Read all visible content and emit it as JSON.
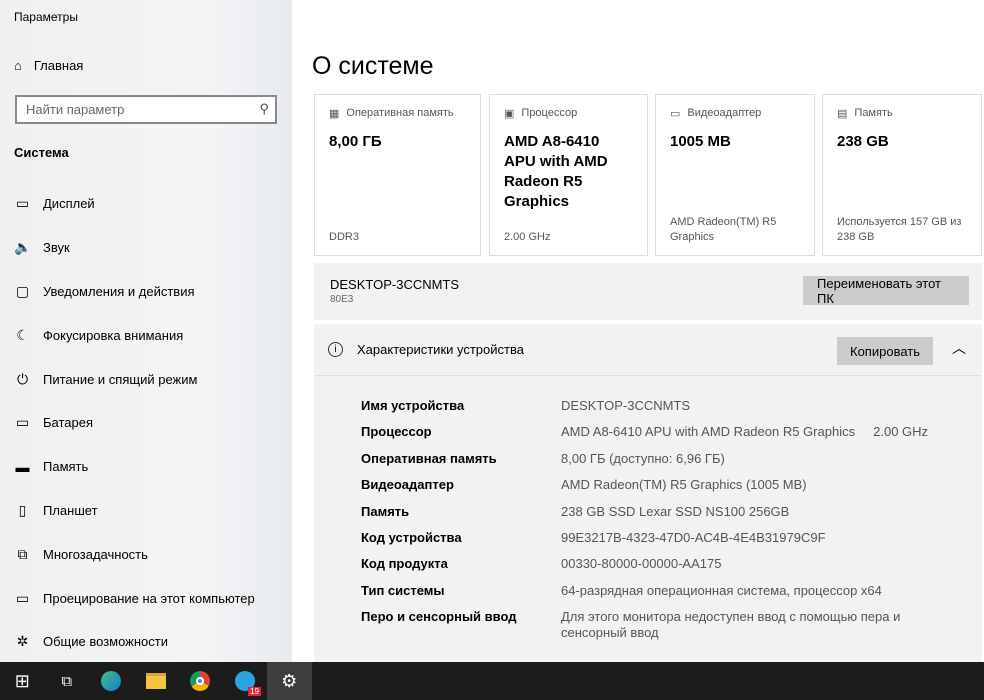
{
  "app_title": "Параметры",
  "sidebar": {
    "home": "Главная",
    "search_placeholder": "Найти параметр",
    "section": "Система",
    "items": [
      {
        "label": "Дисплей",
        "icon": "▭"
      },
      {
        "label": "Звук",
        "icon": "🔈"
      },
      {
        "label": "Уведомления и действия",
        "icon": "▢"
      },
      {
        "label": "Фокусировка внимания",
        "icon": "☾"
      },
      {
        "label": "Питание и спящий режим",
        "icon": "⏻"
      },
      {
        "label": "Батарея",
        "icon": "▭"
      },
      {
        "label": "Память",
        "icon": "▬"
      },
      {
        "label": "Планшет",
        "icon": "▯"
      },
      {
        "label": "Многозадачность",
        "icon": "⧉"
      },
      {
        "label": "Проецирование на этот компьютер",
        "icon": "▭"
      },
      {
        "label": "Общие возможности",
        "icon": "✲"
      }
    ]
  },
  "main": {
    "title": "О системе",
    "cards": [
      {
        "label": "Оперативная память",
        "value": "8,00 ГБ",
        "sub": "DDR3",
        "icon": "▦"
      },
      {
        "label": "Процессор",
        "value": "AMD A8-6410 APU with AMD Radeon R5 Graphics",
        "sub": "2.00 GHz",
        "icon": "▣"
      },
      {
        "label": "Видеоадаптер",
        "value": "1005 MB",
        "sub": "AMD Radeon(TM) R5 Graphics",
        "icon": "▭"
      },
      {
        "label": "Память",
        "value": "238 GB",
        "sub": "Используется 157 GB из 238 GB",
        "icon": "▤"
      }
    ],
    "device_name": "DESKTOP-3CCNMTS",
    "device_id": "80E3",
    "rename_button": "Переименовать этот ПК",
    "specs_title": "Характеристики устройства",
    "copy_button": "Копировать",
    "specs": [
      {
        "k": "Имя устройства",
        "v": "DESKTOP-3CCNMTS"
      },
      {
        "k": "Процессор",
        "v": "AMD A8-6410 APU with AMD Radeon R5 Graphics     2.00 GHz"
      },
      {
        "k": "Оперативная память",
        "v": "8,00 ГБ (доступно: 6,96 ГБ)"
      },
      {
        "k": "Видеоадаптер",
        "v": "AMD Radeon(TM) R5 Graphics (1005 MB)"
      },
      {
        "k": "Память",
        "v": "238 GB SSD Lexar SSD NS100 256GB"
      },
      {
        "k": "Код устройства",
        "v": "99E3217B-4323-47D0-AC4B-4E4B31979C9F"
      },
      {
        "k": "Код продукта",
        "v": "00330-80000-00000-AA175"
      },
      {
        "k": "Тип системы",
        "v": "64-разрядная операционная система, процессор x64"
      },
      {
        "k": "Перо и сенсорный ввод",
        "v": "Для этого монитора недоступен ввод с помощью пера и сенсорный ввод"
      }
    ]
  },
  "taskbar": {
    "telegram_badge": "19"
  }
}
